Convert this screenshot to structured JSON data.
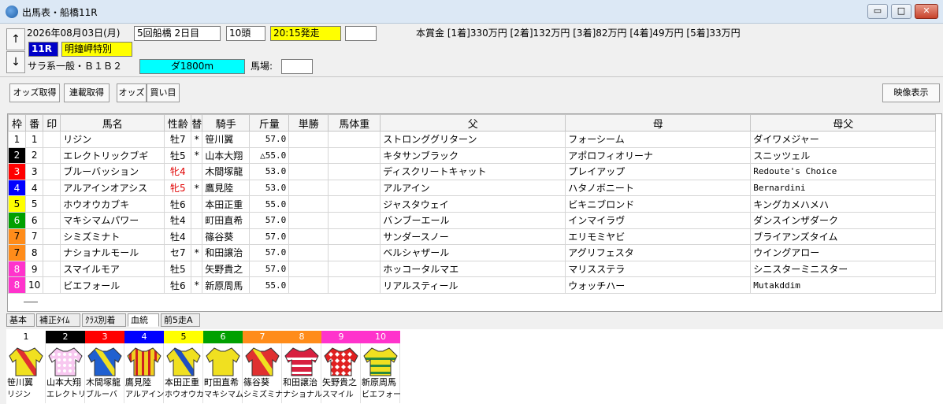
{
  "window": {
    "title": "出馬表・船橋11R",
    "minimize": "▭",
    "maximize": "□",
    "close": "✕"
  },
  "header": {
    "up_arrow": "↑",
    "down_arrow": "↓",
    "date": "2026年08月03日(月)",
    "meeting": "5回船橋 2日目",
    "field_size": "10頭",
    "post_time": "20:15発走",
    "post_time_color": "#ffff00",
    "race_no": "11R",
    "race_no_color": "#0000c8",
    "race_name": "明鐘岬特別",
    "race_name_color": "#ffff00",
    "race_class": "サラ系一般・Ｂ１Ｂ２",
    "distance": "ダ1800m",
    "distance_color": "#00ffff",
    "going_label": "馬場:",
    "going_value": "",
    "extra_value": "",
    "prize": "本賞金 [1着]330万円 [2着]132万円 [3着]82万円 [4着]49万円 [5着]33万円"
  },
  "toolbar": {
    "odds": "オッズ取得",
    "combo": "連載取得",
    "odds2": "オッズ",
    "bets": "買い目",
    "video": "映像表示"
  },
  "table": {
    "columns": [
      "枠",
      "番",
      "印",
      "馬名",
      "性齢",
      "替",
      "騎手",
      "斤量",
      "単勝",
      "馬体重",
      "父",
      "母",
      "母父"
    ],
    "rows": [
      {
        "waku": "1",
        "ban": "1",
        "mark": "",
        "name": "リジン",
        "sexage": "牡7",
        "change": "*",
        "jockey": "笹川翼",
        "weight": "57.0",
        "odds": "",
        "bw": "",
        "sire": "ストロンググリターン",
        "dam": "フォーシーム",
        "damsire": "ダイワメジャー",
        "waku_bg": "#ffffff",
        "waku_fg": "#000000",
        "sex_color": "#000000"
      },
      {
        "waku": "2",
        "ban": "2",
        "mark": "",
        "name": "エレクトリックブギ",
        "sexage": "牡5",
        "change": "*",
        "jockey": "山本大翔",
        "weight": "△55.0",
        "odds": "",
        "bw": "",
        "sire": "キタサンブラック",
        "dam": "アポロフィオリーナ",
        "damsire": "スニッツェル",
        "waku_bg": "#000000",
        "waku_fg": "#ffffff",
        "sex_color": "#000000"
      },
      {
        "waku": "3",
        "ban": "3",
        "mark": "",
        "name": "ブルーバッション",
        "sexage": "牝4",
        "change": "",
        "jockey": "木間塚龍",
        "weight": "53.0",
        "odds": "",
        "bw": "",
        "sire": "ディスクリートキャット",
        "dam": "プレイアップ",
        "damsire": "Redoute's Choice",
        "waku_bg": "#ff0000",
        "waku_fg": "#ffffff",
        "sex_color": "#e00000"
      },
      {
        "waku": "4",
        "ban": "4",
        "mark": "",
        "name": "アルアインオアシス",
        "sexage": "牝5",
        "change": "*",
        "jockey": "鷹見陸",
        "weight": "53.0",
        "odds": "",
        "bw": "",
        "sire": "アルアイン",
        "dam": "ハタノボニート",
        "damsire": "Bernardini",
        "waku_bg": "#0000ff",
        "waku_fg": "#ffffff",
        "sex_color": "#e00000"
      },
      {
        "waku": "5",
        "ban": "5",
        "mark": "",
        "name": "ホウオウカブキ",
        "sexage": "牡6",
        "change": "",
        "jockey": "本田正重",
        "weight": "55.0",
        "odds": "",
        "bw": "",
        "sire": "ジャスタウェイ",
        "dam": "ビキニブロンド",
        "damsire": "キングカメハメハ",
        "waku_bg": "#ffff00",
        "waku_fg": "#000000",
        "sex_color": "#000000"
      },
      {
        "waku": "6",
        "ban": "6",
        "mark": "",
        "name": "マキシマムパワー",
        "sexage": "牡4",
        "change": "",
        "jockey": "町田直希",
        "weight": "57.0",
        "odds": "",
        "bw": "",
        "sire": "バンブーエール",
        "dam": "インマイラヴ",
        "damsire": "ダンスインザダーク",
        "waku_bg": "#00a000",
        "waku_fg": "#ffffff",
        "sex_color": "#000000"
      },
      {
        "waku": "7",
        "ban": "7",
        "mark": "",
        "name": "シミズミナト",
        "sexage": "牡4",
        "change": "",
        "jockey": "篠谷葵",
        "weight": "57.0",
        "odds": "",
        "bw": "",
        "sire": "サンダースノー",
        "dam": "エリモミヤビ",
        "damsire": "ブライアンズタイム",
        "waku_bg": "#ff8c1a",
        "waku_fg": "#000000",
        "sex_color": "#000000"
      },
      {
        "waku": "7",
        "ban": "8",
        "mark": "",
        "name": "ナショナルモール",
        "sexage": "セ7",
        "change": "*",
        "jockey": "和田譲治",
        "weight": "57.0",
        "odds": "",
        "bw": "",
        "sire": "ベルシャザール",
        "dam": "アグリフェスタ",
        "damsire": "ウイングアロー",
        "waku_bg": "#ff8c1a",
        "waku_fg": "#000000",
        "sex_color": "#000000"
      },
      {
        "waku": "8",
        "ban": "9",
        "mark": "",
        "name": "スマイルモア",
        "sexage": "牡5",
        "change": "",
        "jockey": "矢野貴之",
        "weight": "57.0",
        "odds": "",
        "bw": "",
        "sire": "ホッコータルマエ",
        "dam": "マリスステラ",
        "damsire": "シニスターミニスター",
        "waku_bg": "#ff33cc",
        "waku_fg": "#ffffff",
        "sex_color": "#000000"
      },
      {
        "waku": "8",
        "ban": "10",
        "mark": "",
        "name": "ビエフォール",
        "sexage": "牡6",
        "change": "*",
        "jockey": "新原周馬",
        "weight": "55.0",
        "odds": "",
        "bw": "",
        "sire": "リアルスティール",
        "dam": "ウォッチハー",
        "damsire": "Mutakddim",
        "waku_bg": "#ff33cc",
        "waku_fg": "#ffffff",
        "sex_color": "#000000"
      }
    ]
  },
  "tabs": [
    "基本",
    "補正ﾀｲﾑ",
    "ｸﾗｽ別着",
    "血統",
    "前5走A"
  ],
  "active_tab": "血統",
  "silks": [
    {
      "num": "1",
      "jockey": "笹川翼",
      "horse": "リジン",
      "num_bg": "#ffffff",
      "num_fg": "#000000",
      "body": "#f0e020",
      "pattern": "sash",
      "accent": "#e03030"
    },
    {
      "num": "2",
      "jockey": "山本大翔",
      "horse": "エレクトリ",
      "num_bg": "#000000",
      "num_fg": "#ffffff",
      "body": "#f8c8f0",
      "pattern": "dots",
      "accent": "#ffffff"
    },
    {
      "num": "3",
      "jockey": "木間塚龍",
      "horse": "ブルーバ",
      "num_bg": "#ff0000",
      "num_fg": "#ffffff",
      "body": "#2060d0",
      "pattern": "sash",
      "accent": "#f0e020"
    },
    {
      "num": "4",
      "jockey": "鷹見陸",
      "horse": "アルアイン",
      "num_bg": "#0000ff",
      "num_fg": "#ffffff",
      "body": "#f0d020",
      "pattern": "stripes",
      "accent": "#d02020"
    },
    {
      "num": "5",
      "jockey": "本田正重",
      "horse": "ホウオウカ",
      "num_bg": "#ffff00",
      "num_fg": "#000000",
      "body": "#f0e020",
      "pattern": "sash",
      "accent": "#2050c0"
    },
    {
      "num": "6",
      "jockey": "町田直希",
      "horse": "マキシマム",
      "num_bg": "#00a000",
      "num_fg": "#ffffff",
      "body": "#f0e020",
      "pattern": "plain",
      "accent": "#f0e020"
    },
    {
      "num": "7",
      "jockey": "篠谷葵",
      "horse": "シミズミナ",
      "num_bg": "#ff8c1a",
      "num_fg": "#ffffff",
      "body": "#e03030",
      "pattern": "sash",
      "accent": "#f0e020"
    },
    {
      "num": "8",
      "jockey": "和田譲治",
      "horse": "ナショナル",
      "num_bg": "#ff8c1a",
      "num_fg": "#ffffff",
      "body": "#d82040",
      "pattern": "hoops",
      "accent": "#ffffff"
    },
    {
      "num": "9",
      "jockey": "矢野貴之",
      "horse": "スマイル",
      "num_bg": "#ff33cc",
      "num_fg": "#ffffff",
      "body": "#e02020",
      "pattern": "diamonds",
      "accent": "#ffffff"
    },
    {
      "num": "10",
      "jockey": "新原周馬",
      "horse": "ビエフォー",
      "num_bg": "#ff33cc",
      "num_fg": "#ffffff",
      "body": "#f0e020",
      "pattern": "hoops",
      "accent": "#2a8a40"
    }
  ]
}
